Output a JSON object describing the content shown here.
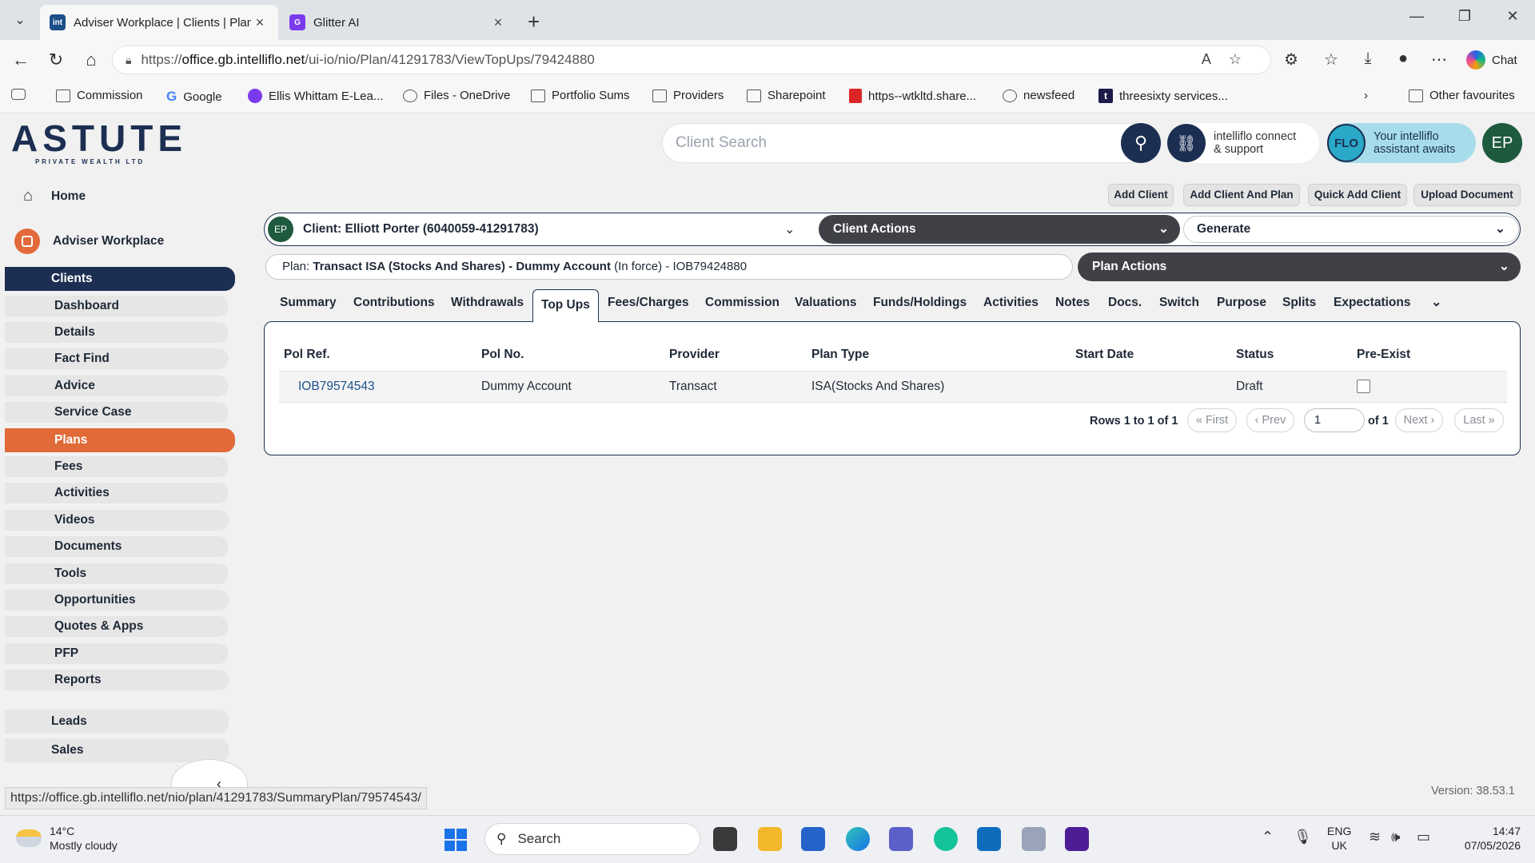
{
  "browser": {
    "tabs": [
      {
        "title": "Adviser Workplace | Clients | Plans",
        "favicon": "int"
      },
      {
        "title": "Glitter AI",
        "favicon": "G"
      }
    ],
    "url_prefix": "https://",
    "url_host": "office.gb.intelliflo.net",
    "url_path": "/ui-io/nio/Plan/41291783/ViewTopUps/79424880",
    "copilot_label": "Chat",
    "favourites": [
      "Commission",
      "Google",
      "Ellis Whittam E-Lea...",
      "Files - OneDrive",
      "Portfolio Sums",
      "Providers",
      "Sharepoint",
      "https--wtkltd.share...",
      "newsfeed",
      "threesixty services..."
    ],
    "other_favourites": "Other favourites"
  },
  "brand": {
    "name": "STUTE",
    "letter": "A",
    "sub": "PRIVATE WEALTH LTD"
  },
  "header": {
    "search_placeholder": "Client Search",
    "connect_line1": "intelliflo connect",
    "connect_line2": "& support",
    "flo_badge": "FLO",
    "flo_line1": "Your intelliflo",
    "flo_line2": "assistant awaits",
    "avatar": "EP"
  },
  "sidebar": {
    "home": "Home",
    "adviser_workplace": "Adviser Workplace",
    "clients": "Clients",
    "items": [
      "Dashboard",
      "Details",
      "Fact Find",
      "Advice",
      "Service Case"
    ],
    "plans": "Plans",
    "items2": [
      "Fees",
      "Activities",
      "Videos",
      "Documents",
      "Tools",
      "Opportunities",
      "Quotes & Apps",
      "PFP",
      "Reports"
    ],
    "leads": "Leads",
    "sales": "Sales"
  },
  "actions": {
    "add_client": "Add Client",
    "add_client_plan": "Add Client And Plan",
    "quick_add": "Quick Add Client",
    "upload": "Upload Document"
  },
  "client_bar": {
    "initials": "EP",
    "label": "Client: Elliott Porter (6040059-41291783)",
    "client_actions": "Client Actions",
    "generate": "Generate"
  },
  "plan_bar": {
    "prefix": "Plan: ",
    "name": "Transact ISA (Stocks And Shares) - Dummy Account",
    "status": " (In force) - IOB79424880",
    "plan_actions": "Plan Actions"
  },
  "tabs": [
    "Summary",
    "Contributions",
    "Withdrawals",
    "Top Ups",
    "Fees/Charges",
    "Commission",
    "Valuations",
    "Funds/Holdings",
    "Activities",
    "Notes",
    "Docs.",
    "Switch",
    "Purpose",
    "Splits",
    "Expectations"
  ],
  "table": {
    "columns": [
      "Pol Ref.",
      "Pol No.",
      "Provider",
      "Plan Type",
      "Start Date",
      "Status",
      "Pre-Exist"
    ],
    "rows": [
      {
        "pol_ref": "IOB79574543",
        "pol_no": "Dummy Account",
        "provider": "Transact",
        "plan_type": "ISA(Stocks And Shares)",
        "start_date": "",
        "status": "Draft",
        "pre_exist": false
      }
    ]
  },
  "pager": {
    "rows_text": "Rows 1 to 1 of 1",
    "first": "« First",
    "prev": "‹ Prev",
    "page": "1",
    "of": "of 1",
    "next": "Next ›",
    "last": "Last »"
  },
  "version": "Version: 38.53.1",
  "status_url": "https://office.gb.intelliflo.net/nio/plan/41291783/SummaryPlan/79574543/",
  "taskbar": {
    "temp": "14°C",
    "weather": "Mostly cloudy",
    "search": "Search",
    "lang1": "ENG",
    "lang2": "UK",
    "time": "14:47",
    "date": "07/05/2026"
  },
  "colors": {
    "navy": "#1c2f52",
    "orange": "#e06b39",
    "dark_pill": "#3f4147",
    "avatar_green": "#1e5a3e"
  }
}
